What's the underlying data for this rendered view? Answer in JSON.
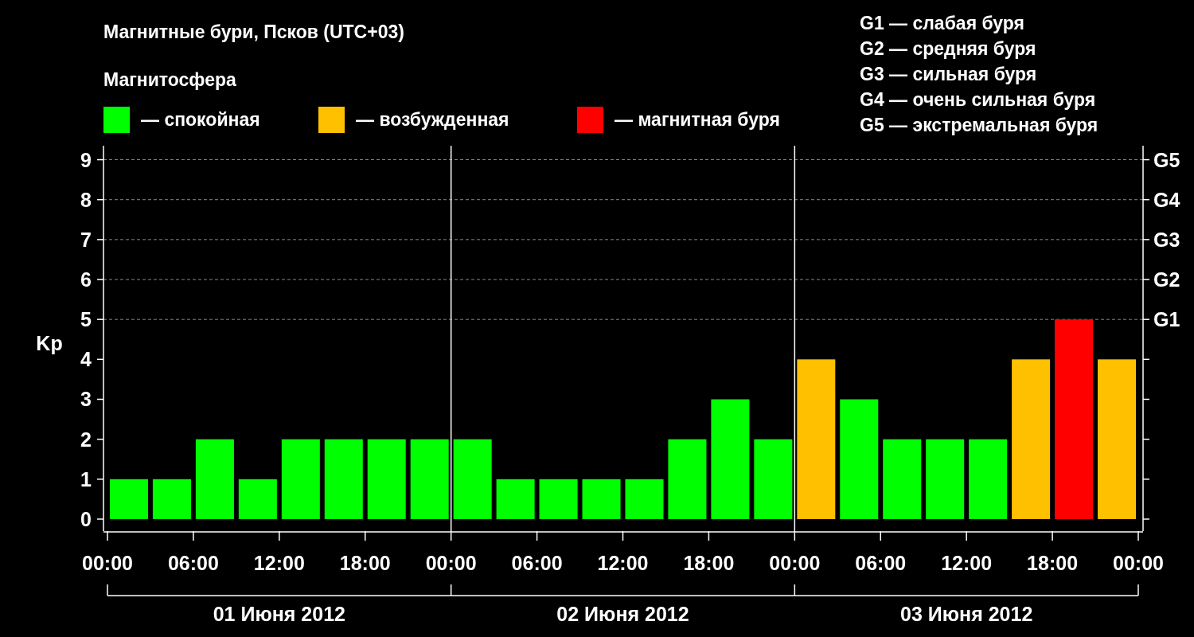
{
  "title": "Магнитные бури, Псков (UTC+03)",
  "legend_title": "Магнитосфера",
  "storm_scale": [
    "G1 — слабая буря",
    "G2 — средняя буря",
    "G3 — сильная буря",
    "G4 — очень сильная буря",
    "G5 — экстремальная буря"
  ],
  "chart_data": {
    "type": "bar",
    "ylabel": "Kp",
    "stacked": true,
    "grid": true,
    "legend": "top",
    "categories": [
      null,
      null,
      null,
      null,
      null,
      null,
      null,
      null,
      null,
      null,
      null,
      null,
      null,
      null,
      null,
      null,
      null,
      null,
      null,
      null,
      null,
      null,
      null,
      null
    ],
    "series": [
      {
        "name": "— спокойная",
        "color": "#00ff00",
        "values": [
          1,
          1,
          2,
          1,
          2,
          2,
          2,
          2,
          2,
          1,
          1,
          1,
          1,
          2,
          3,
          2,
          null,
          3,
          2,
          2,
          2,
          null,
          null,
          null
        ]
      },
      {
        "name": "— возбужденная",
        "color": "#ffc000",
        "values": [
          null,
          null,
          null,
          null,
          null,
          null,
          null,
          null,
          null,
          null,
          null,
          null,
          null,
          null,
          null,
          null,
          4,
          null,
          null,
          null,
          null,
          4,
          null,
          4
        ]
      },
      {
        "name": "— магнитная буря",
        "color": "#ff0000",
        "values": [
          null,
          null,
          null,
          null,
          null,
          null,
          null,
          null,
          null,
          null,
          null,
          null,
          null,
          null,
          null,
          null,
          null,
          null,
          null,
          null,
          null,
          null,
          5,
          null
        ]
      }
    ],
    "ylim": [
      -0.3,
      9.35
    ],
    "yticks": [
      0,
      1,
      2,
      3,
      4,
      5,
      6,
      7,
      8,
      9
    ]
  },
  "time_labels": [
    "00:00",
    "06:00",
    "12:00",
    "18:00",
    "00:00",
    "06:00",
    "12:00",
    "18:00",
    "00:00",
    "06:00",
    "12:00",
    "18:00",
    "00:00"
  ],
  "storm_levels": [
    "G5",
    "G4",
    "G3",
    "G2",
    "G1"
  ],
  "dates": [
    "01 Июня 2012",
    "02 Июня 2012",
    "03 Июня 2012"
  ]
}
